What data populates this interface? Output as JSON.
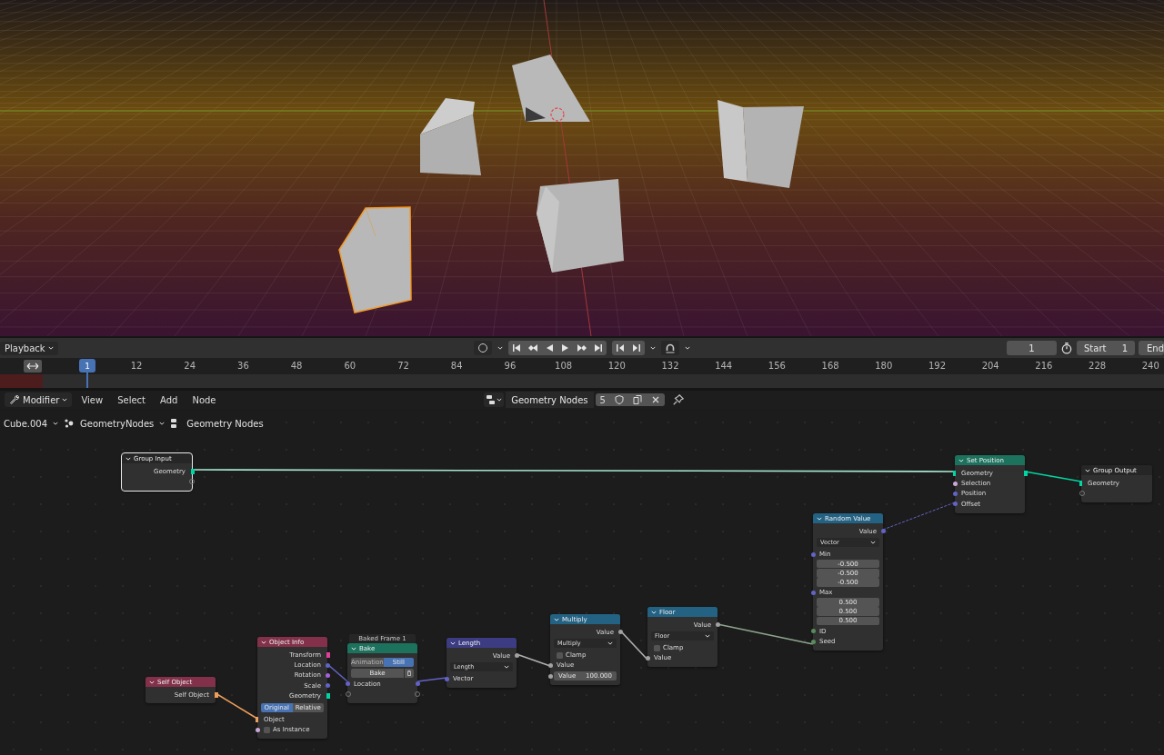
{
  "timeline": {
    "playback_menu": "Playback",
    "current_frame": "1",
    "start_label": "Start",
    "start_value": "1",
    "end_label": "End",
    "ruler": {
      "current": "1",
      "ticks": [
        "12",
        "24",
        "36",
        "48",
        "60",
        "72",
        "84",
        "96",
        "108",
        "120",
        "132",
        "144",
        "156",
        "168",
        "180",
        "192",
        "204",
        "216",
        "228",
        "240"
      ]
    }
  },
  "node_editor": {
    "header": {
      "editor_menu": "Modifier",
      "menus": [
        "View",
        "Select",
        "Add",
        "Node"
      ],
      "tree_name": "Geometry Nodes",
      "users": "5"
    },
    "breadcrumbs": [
      "Cube.004",
      "GeometryNodes",
      "Geometry Nodes"
    ],
    "nodes": [
      {
        "title": "Group Input",
        "color": "#262626",
        "selected": true,
        "rows": [
          {
            "kind": "output",
            "label": "Geometry",
            "color": "#00d6a3"
          },
          {
            "kind": "spare_output"
          }
        ]
      },
      {
        "title": "Set Position",
        "color": "#1d725e",
        "selected": false,
        "rows": [
          {
            "kind": "through",
            "label": "Geometry",
            "color": "#00d6a3"
          },
          {
            "kind": "input",
            "label": "Selection",
            "color": "#cca6d6"
          },
          {
            "kind": "input",
            "label": "Position",
            "color": "#6363c7"
          },
          {
            "kind": "input",
            "label": "Offset",
            "color": "#6363c7"
          }
        ]
      },
      {
        "title": "Group Output",
        "color": "#262626",
        "selected": false,
        "rows": [
          {
            "kind": "input",
            "label": "Geometry",
            "color": "#00d6a3"
          },
          {
            "kind": "spare_input"
          }
        ]
      },
      {
        "title": "Random Value",
        "color": "#246283",
        "selected": false,
        "rows": [
          {
            "kind": "output",
            "label": "Value",
            "color": "#6363c7"
          },
          {
            "kind": "dropdown",
            "value": "Vector"
          },
          {
            "kind": "input",
            "label": "Min",
            "color": "#6363c7"
          },
          {
            "kind": "field",
            "value": "-0.500"
          },
          {
            "kind": "field",
            "value": "-0.500"
          },
          {
            "kind": "field",
            "value": "-0.500"
          },
          {
            "kind": "input",
            "label": "Max",
            "color": "#6363c7"
          },
          {
            "kind": "field",
            "value": "0.500"
          },
          {
            "kind": "field",
            "value": "0.500"
          },
          {
            "kind": "field",
            "value": "0.500"
          },
          {
            "kind": "input",
            "label": "ID",
            "color": "#598c5c"
          },
          {
            "kind": "input",
            "label": "Seed",
            "color": "#598c5c"
          }
        ]
      },
      {
        "title": "Floor",
        "color": "#246283",
        "selected": false,
        "rows": [
          {
            "kind": "output",
            "label": "Value",
            "color": "#a1a1a1"
          },
          {
            "kind": "dropdown",
            "value": "Floor"
          },
          {
            "kind": "checkbox",
            "label": "Clamp",
            "checked": false
          },
          {
            "kind": "input",
            "label": "Value",
            "color": "#a1a1a1"
          }
        ]
      },
      {
        "title": "Multiply",
        "color": "#246283",
        "selected": false,
        "rows": [
          {
            "kind": "output",
            "label": "Value",
            "color": "#a1a1a1"
          },
          {
            "kind": "dropdown",
            "value": "Multiply"
          },
          {
            "kind": "checkbox",
            "label": "Clamp",
            "checked": false
          },
          {
            "kind": "input",
            "label": "Value",
            "color": "#a1a1a1"
          },
          {
            "kind": "field",
            "label": "Value",
            "value": "100.000",
            "color": "#a1a1a1"
          }
        ]
      },
      {
        "title": "Object Info",
        "color": "#83314a",
        "selected": false,
        "rows": [
          {
            "kind": "output",
            "label": "Transform",
            "color": "#e0409a"
          },
          {
            "kind": "output",
            "label": "Location",
            "color": "#6363c7"
          },
          {
            "kind": "output",
            "label": "Rotation",
            "color": "#a363d9"
          },
          {
            "kind": "output",
            "label": "Scale",
            "color": "#6363c7"
          },
          {
            "kind": "output",
            "label": "Geometry",
            "color": "#00d6a3"
          },
          {
            "kind": "toggle",
            "options": [
              {
                "label": "Original",
                "selected": true
              },
              {
                "label": "Relative",
                "selected": false
              }
            ]
          },
          {
            "kind": "input",
            "label": "Object",
            "color": "#ed9e5c"
          },
          {
            "kind": "checkbox",
            "label": "As Instance",
            "checked": false,
            "color": "#cca6d6"
          }
        ]
      },
      {
        "title": "Bake",
        "frame_label": "Baked Frame 1",
        "color": "#1d725e",
        "selected": false,
        "rows": [
          {
            "kind": "toggle",
            "options": [
              {
                "label": "Animation",
                "selected": false
              },
              {
                "label": "Still",
                "selected": true
              }
            ]
          },
          {
            "kind": "button",
            "label": "Bake"
          },
          {
            "kind": "through",
            "label": "Location",
            "color": "#6363c7"
          },
          {
            "kind": "spare_through"
          }
        ]
      },
      {
        "title": "Length",
        "color": "#3c3c83",
        "selected": false,
        "rows": [
          {
            "kind": "output",
            "label": "Value",
            "color": "#a1a1a1"
          },
          {
            "kind": "dropdown",
            "value": "Length"
          },
          {
            "kind": "input",
            "label": "Vector",
            "color": "#6363c7"
          }
        ]
      },
      {
        "title": "Self Object",
        "color": "#83314a",
        "selected": false,
        "rows": [
          {
            "kind": "output",
            "label": "Self Object",
            "color": "#ed9e5c"
          }
        ]
      }
    ]
  }
}
